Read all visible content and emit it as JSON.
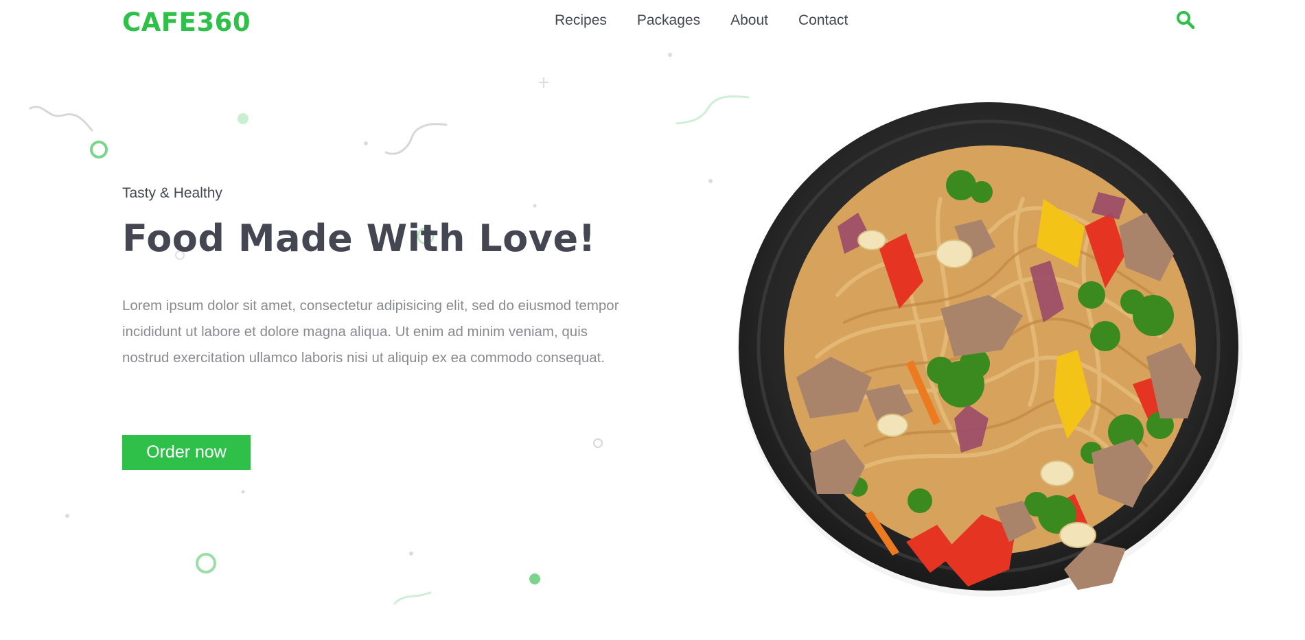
{
  "brand": {
    "name": "CAFE360",
    "color": "#2fc04a"
  },
  "nav": {
    "items": [
      {
        "label": "Recipes"
      },
      {
        "label": "Packages"
      },
      {
        "label": "About"
      },
      {
        "label": "Contact"
      }
    ],
    "search_icon": "search-icon"
  },
  "hero": {
    "eyebrow": "Tasty & Healthy",
    "headline": "Food Made With Love!",
    "description": "Lorem ipsum dolor sit amet, consectetur adipisicing elit, sed do eiusmod tempor incididunt ut labore et dolore magna aliqua. Ut enim ad minim veniam, quis nostrud exercitation ullamco laboris nisi ut aliquip ex ea commodo consequat.",
    "cta_label": "Order now",
    "image": "noodle-stir-fry-bowl"
  },
  "colors": {
    "accent": "#2fc04a",
    "text": "#444751",
    "muted": "#8a8b90"
  }
}
